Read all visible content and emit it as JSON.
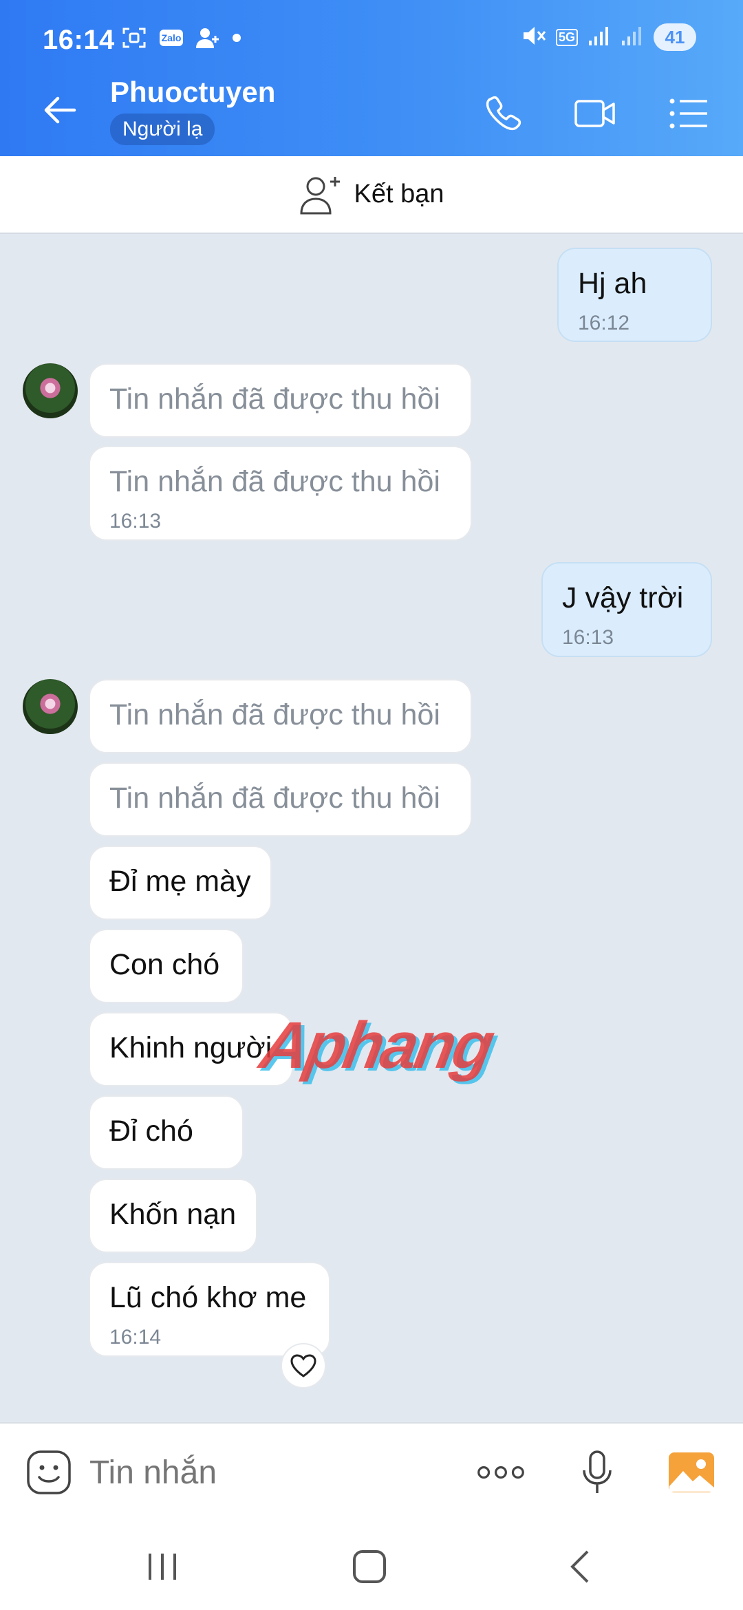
{
  "status_bar": {
    "time": "16:14",
    "zalo_badge": "Zalo",
    "network": "5G",
    "battery": "41"
  },
  "header": {
    "title": "Phuoctuyen",
    "subtitle": "Người lạ"
  },
  "add_friend": {
    "label": "Kết bạn"
  },
  "messages": [
    {
      "dir": "out",
      "text": "Hj ah",
      "time": "16:12"
    },
    {
      "dir": "in",
      "text": "Tin nhắn đã được thu hồi",
      "recalled": true
    },
    {
      "dir": "in",
      "text": "Tin nhắn đã được thu hồi",
      "recalled": true,
      "time": "16:13"
    },
    {
      "dir": "out",
      "text": "J vậy trời",
      "time": "16:13"
    },
    {
      "dir": "in",
      "text": "Tin nhắn đã được thu hồi",
      "recalled": true
    },
    {
      "dir": "in",
      "text": "Tin nhắn đã được thu hồi",
      "recalled": true
    },
    {
      "dir": "in",
      "text": "Đỉ mẹ mày"
    },
    {
      "dir": "in",
      "text": "Con chó"
    },
    {
      "dir": "in",
      "text": "Khinh người"
    },
    {
      "dir": "in",
      "text": "Đỉ chó"
    },
    {
      "dir": "in",
      "text": "Khốn nạn"
    },
    {
      "dir": "in",
      "text": "Lũ chó khơ me",
      "time": "16:14"
    }
  ],
  "watermark": "Aphang",
  "input": {
    "placeholder": "Tin nhắn"
  },
  "colors": {
    "header_start": "#2f7af3",
    "header_end": "#57a9f9",
    "outgoing_bubble": "#dbedfd",
    "chat_bg": "#e2e8ef"
  }
}
